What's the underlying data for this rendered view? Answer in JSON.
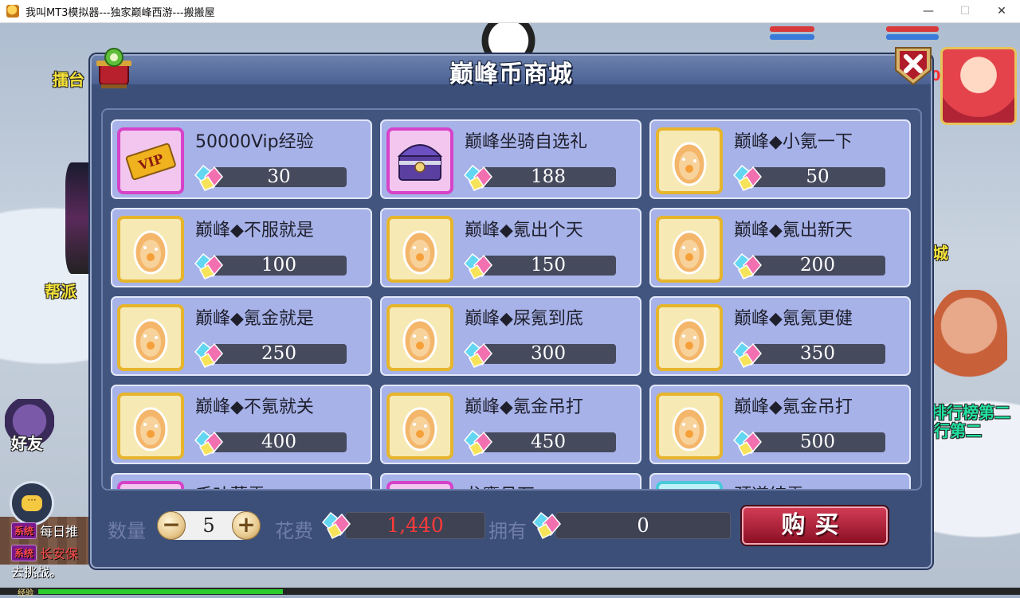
{
  "window": {
    "title": "我叫MT3模拟器---独家巅峰西游---搬搬屋",
    "minimize": "—",
    "maximize": "☐",
    "close": "✕"
  },
  "scene": {
    "labels": {
      "arena": "擂台",
      "guild": "帮派",
      "friends": "好友",
      "city": "城",
      "rank_line1": "排行榜第二",
      "rank_line2": "行第二"
    },
    "exp_label": "经验",
    "exp_progress": 0.24,
    "chat": [
      {
        "badge": "系统",
        "text": "每日推"
      },
      {
        "badge": "系统",
        "text": "长安保"
      }
    ],
    "chat_tail": "去挑战。",
    "hp_value": "0"
  },
  "shop": {
    "title": "巅峰币商城",
    "items": [
      {
        "name": "50000Vip经验",
        "price": "30",
        "frame": "pink",
        "icon": "vip-ticket"
      },
      {
        "name": "巅峰坐骑自选礼",
        "price": "188",
        "frame": "pink",
        "icon": "treasure-chest"
      },
      {
        "name": "巅峰◆小氪一下",
        "price": "50",
        "frame": "gold",
        "icon": "egg"
      },
      {
        "name": "巅峰◆不服就是",
        "price": "100",
        "frame": "gold",
        "icon": "egg"
      },
      {
        "name": "巅峰◆氪出个天",
        "price": "150",
        "frame": "gold",
        "icon": "egg"
      },
      {
        "name": "巅峰◆氪出新天",
        "price": "200",
        "frame": "gold",
        "icon": "egg"
      },
      {
        "name": "巅峰◆氪金就是",
        "price": "250",
        "frame": "gold",
        "icon": "egg"
      },
      {
        "name": "巅峰◆屎氪到底",
        "price": "300",
        "frame": "gold",
        "icon": "egg"
      },
      {
        "name": "巅峰◆氪氪更健",
        "price": "350",
        "frame": "gold",
        "icon": "egg"
      },
      {
        "name": "巅峰◆不氪就关",
        "price": "400",
        "frame": "gold",
        "icon": "egg"
      },
      {
        "name": "巅峰◆氪金吊打",
        "price": "450",
        "frame": "gold",
        "icon": "egg"
      },
      {
        "name": "巅峰◆氪金吊打",
        "price": "500",
        "frame": "gold",
        "icon": "egg"
      },
      {
        "name": "千叶葬雪",
        "price": "",
        "frame": "pink",
        "icon": "partial"
      },
      {
        "name": "龙鹰月石",
        "price": "",
        "frame": "pink",
        "icon": "partial"
      },
      {
        "name": "颈道结雪",
        "price": "",
        "frame": "cyan",
        "icon": "partial"
      }
    ],
    "quantity_label": "数量",
    "quantity": "5",
    "minus": "−",
    "plus": "+",
    "cost_label": "花费",
    "cost": "1,440",
    "owned_label": "拥有",
    "owned": "0",
    "buy_label": "购买"
  },
  "colors": {
    "panel": "#3c4f79",
    "card": "#a6b2e8",
    "cost": "#ff3a3a",
    "buy": "#b32440"
  }
}
